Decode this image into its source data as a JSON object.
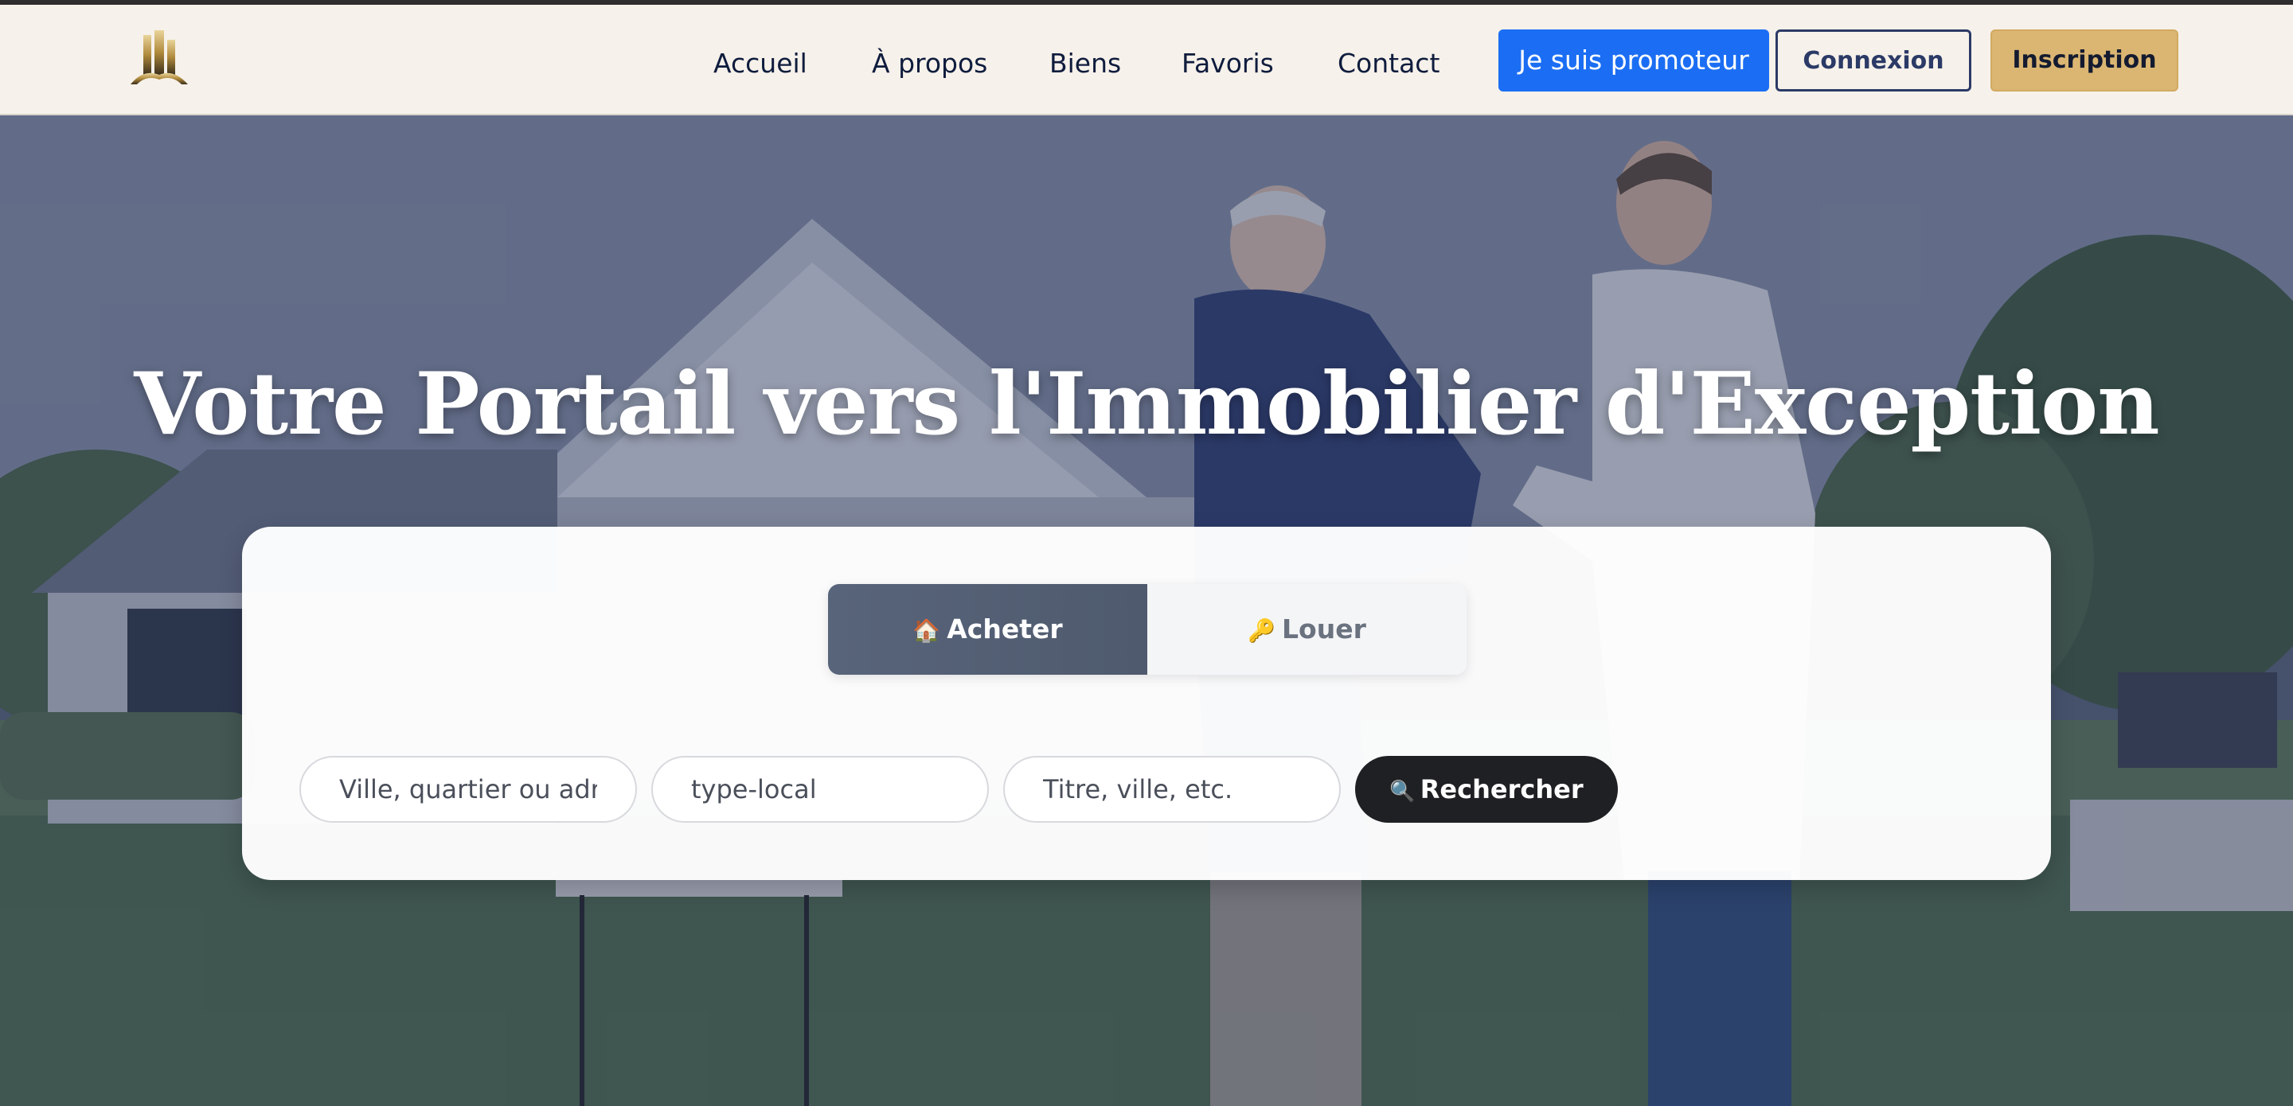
{
  "nav": {
    "logo_alt": "logo",
    "links": [
      "Accueil",
      "À propos",
      "Biens",
      "Favoris",
      "Contact"
    ],
    "promoteur_label": "Je suis promoteur",
    "connexion_label": "Connexion",
    "inscription_label": "Inscription"
  },
  "hero": {
    "title": "Votre Portail vers l'Immobilier d'Exception"
  },
  "search": {
    "tabs": [
      {
        "label": "Acheter",
        "icon": "house-icon",
        "active": true
      },
      {
        "label": "Louer",
        "icon": "key-icon",
        "active": false
      }
    ],
    "location_placeholder": "Ville, quartier ou adresse",
    "type_value": "type-local",
    "title_placeholder": "Titre, ville, etc.",
    "submit_label": "Rechercher",
    "submit_icon": "magnifier-icon"
  },
  "colors": {
    "accent_blue": "#1b6ef3",
    "gold": "#dbb672",
    "navy": "#0f1c3d"
  }
}
